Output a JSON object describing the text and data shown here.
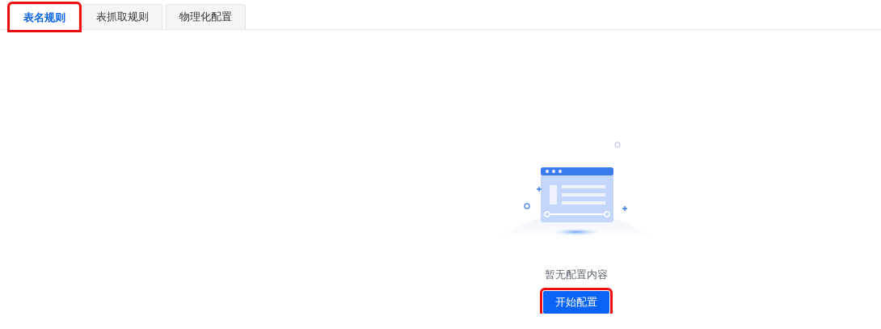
{
  "tabs": [
    {
      "label": "表名规则",
      "selected": true,
      "highlighted": true
    },
    {
      "label": "表抓取规则",
      "selected": false,
      "highlighted": false
    },
    {
      "label": "物理化配置",
      "selected": false,
      "highlighted": false
    }
  ],
  "empty_state": {
    "message": "暂无配置内容",
    "button": {
      "label": "开始配置",
      "highlighted": true
    }
  }
}
